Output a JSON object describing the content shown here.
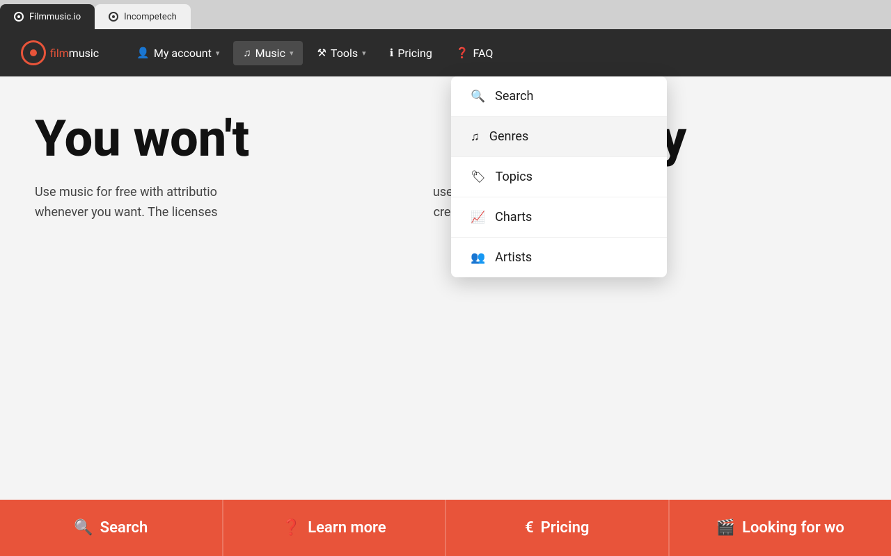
{
  "tabs": [
    {
      "id": "filmmusic",
      "label": "Filmmusic.io",
      "active": true
    },
    {
      "id": "incompetech",
      "label": "Incompetech",
      "active": false
    }
  ],
  "navbar": {
    "logo": {
      "film": "film",
      "music": "music"
    },
    "items": [
      {
        "id": "my-account",
        "label": "My account",
        "icon": "👤",
        "has_dropdown": true
      },
      {
        "id": "music",
        "label": "Music",
        "icon": "♫",
        "has_dropdown": true,
        "active": true
      },
      {
        "id": "tools",
        "label": "Tools",
        "icon": "⚒",
        "has_dropdown": true
      },
      {
        "id": "pricing",
        "label": "Pricing",
        "icon": "ℹ",
        "has_dropdown": false
      },
      {
        "id": "faq",
        "label": "FAQ",
        "icon": "❓",
        "has_dropdown": false
      }
    ]
  },
  "dropdown": {
    "items": [
      {
        "id": "search",
        "label": "Search",
        "icon": "🔍"
      },
      {
        "id": "genres",
        "label": "Genres",
        "icon": "♫",
        "highlighted": true
      },
      {
        "id": "topics",
        "label": "Topics",
        "icon": "🏷"
      },
      {
        "id": "charts",
        "label": "Charts",
        "icon": "📈"
      },
      {
        "id": "artists",
        "label": "Artists",
        "icon": "👥"
      }
    ]
  },
  "hero": {
    "title": "You won't    nis any",
    "title_left": "You won't",
    "title_right": "nis any",
    "subtitle_left": "Use music for free with attributio",
    "subtitle_right": "use forever: Buy lif",
    "subtitle_left2": "whenever you want. The licenses",
    "subtitle_right2": "creation of projec"
  },
  "cta_buttons": [
    {
      "id": "search",
      "label": "Search",
      "icon": "🔍"
    },
    {
      "id": "learn-more",
      "label": "Learn more",
      "icon": "❓"
    },
    {
      "id": "pricing",
      "label": "Pricing",
      "icon": "€"
    },
    {
      "id": "looking-for-work",
      "label": "Looking for wo",
      "icon": "🎬"
    }
  ],
  "colors": {
    "accent": "#e8543a",
    "navbar_bg": "#2c2c2c",
    "hero_bg": "#f4f4f4"
  }
}
